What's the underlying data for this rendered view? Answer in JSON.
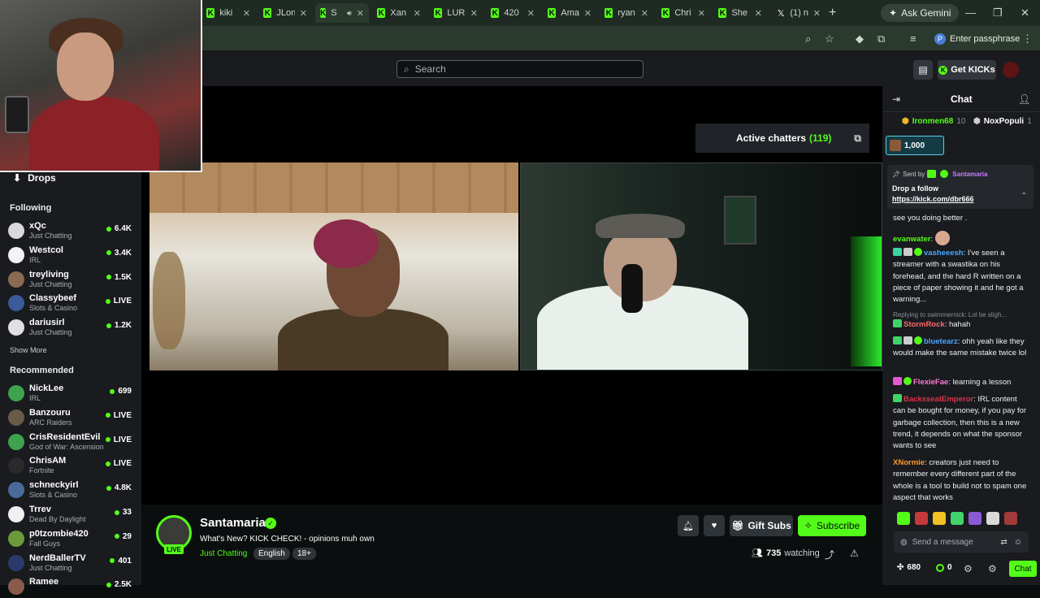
{
  "browser": {
    "tabs": [
      {
        "title": "kiki",
        "icon": "kick"
      },
      {
        "title": "JLon",
        "icon": "kick"
      },
      {
        "title": "S",
        "icon": "kick",
        "active": true
      },
      {
        "title": "Xan",
        "icon": "kick"
      },
      {
        "title": "LUR",
        "icon": "kick"
      },
      {
        "title": "420",
        "icon": "kick"
      },
      {
        "title": "Ama",
        "icon": "kick"
      },
      {
        "title": "ryan",
        "icon": "kick"
      },
      {
        "title": "Chri",
        "icon": "kick"
      },
      {
        "title": "She",
        "icon": "kick"
      },
      {
        "title": "(1) n",
        "icon": "x"
      }
    ],
    "ask_gemini": "Ask Gemini",
    "passphrase": "Enter passphrase",
    "passphrase_initial": "P"
  },
  "header": {
    "search_placeholder": "Search",
    "get_kicks": "Get KICKs"
  },
  "sidebar": {
    "drops": "Drops",
    "following_title": "Following",
    "following": [
      {
        "name": "xQc",
        "category": "Just Chatting",
        "viewers": "6.4K",
        "color": "#d9d9d9"
      },
      {
        "name": "Westcol",
        "category": "IRL",
        "viewers": "3.4K",
        "color": "#f2f2f2"
      },
      {
        "name": "treyliving",
        "category": "Just Chatting",
        "viewers": "1.5K",
        "color": "#8a6a50"
      },
      {
        "name": "Classybeef",
        "category": "Slots & Casino",
        "viewers": "LIVE",
        "color": "#3a5a9a"
      },
      {
        "name": "dariusirl",
        "category": "Just Chatting",
        "viewers": "1.2K",
        "color": "#e0e0e0"
      }
    ],
    "show_more": "Show More",
    "recommended_title": "Recommended",
    "recommended": [
      {
        "name": "NickLee",
        "category": "IRL",
        "viewers": "699",
        "color": "#3fa34d"
      },
      {
        "name": "Banzouru",
        "category": "ARC Raiders",
        "viewers": "LIVE",
        "color": "#6a5a48"
      },
      {
        "name": "CrisResidentEvil",
        "category": "God of War: Ascension",
        "viewers": "LIVE",
        "color": "#3fa34d"
      },
      {
        "name": "ChrisAM",
        "category": "Fortnite",
        "viewers": "LIVE",
        "color": "#2a2a2a"
      },
      {
        "name": "schneckyirl",
        "category": "Slots & Casino",
        "viewers": "4.8K",
        "color": "#4a6a9a"
      },
      {
        "name": "Trrev",
        "category": "Dead By Daylight",
        "viewers": "33",
        "color": "#f0f0f0"
      },
      {
        "name": "p0tzombie420",
        "category": "Fall Guys",
        "viewers": "29",
        "color": "#6a9a3a"
      },
      {
        "name": "NerdBallerTV",
        "category": "Just Chatting",
        "viewers": "401",
        "color": "#2a3a6a"
      },
      {
        "name": "Ramee",
        "category": "",
        "viewers": "2.5K",
        "color": "#8a5a4a"
      }
    ]
  },
  "player": {
    "active_chatters_label": "Active chatters",
    "active_chatters_count": "(119)"
  },
  "stream": {
    "streamer": "Santamaria",
    "title": "What's New? KICK CHECK! - opinions muh own",
    "category": "Just Chatting",
    "tags": [
      "English",
      "18+"
    ],
    "live_badge": "LIVE",
    "gift_subs": "Gift Subs",
    "subscribe": "Subscribe",
    "viewers": "735",
    "watching_label": "watching"
  },
  "chat": {
    "title": "Chat",
    "leaderboard": [
      {
        "name": "Ironmen68",
        "count": "10"
      },
      {
        "name": "NoxPopuli",
        "count": "1"
      }
    ],
    "goal_value": "1,000",
    "pinned": {
      "sent_by": "Sent by",
      "sender": "Santamaria",
      "message": "Drop a follow",
      "link": "https://kick.com/dbr666"
    },
    "messages": [
      {
        "user": "",
        "user_color": "#eef0f2",
        "text": "see you doing better .",
        "badges": []
      },
      {
        "user": "evanwater",
        "user_color": "#53fc18",
        "text": "",
        "badges": []
      },
      {
        "user": "vasheeesh",
        "user_color": "#4aa8ff",
        "text": "I've seen a streamer with a swastika on his forehead, and the hard R written on a piece of paper showing it and he got a warning...",
        "badges": [
          "#3fd3a0",
          "#cccccc",
          "verified"
        ]
      },
      {
        "user": "StormRock",
        "user_color": "#ff6b6b",
        "text": "hahah",
        "badges": [
          "#3fd36a"
        ]
      },
      {
        "user": "bluetearz",
        "user_color": "#4aa8ff",
        "text": "ohh yeah like they would make the same mistake twice lol",
        "badges": [
          "#3fd36a",
          "#cccccc",
          "verified"
        ]
      },
      {
        "user": "FlexieFae",
        "user_color": "#ff7ad9",
        "text": "learning a lesson",
        "badges": [
          "#e35ad0",
          "verified"
        ]
      },
      {
        "user": "BacksseatEmperor",
        "user_color": "#e0304a",
        "text": "IRL content can be bought for money, if you pay for garbage collection, then this is a new trend, it depends on what the sponsor wants to see",
        "badges": [
          "#3fd36a"
        ]
      },
      {
        "user": "XNormie",
        "user_color": "#ff9a2a",
        "text": "creators just need to remember every different part of the whole is a tool to build not to spam one aspect that works",
        "badges": []
      }
    ],
    "reply_label": "Replying to swimmernick: Lol be sligh...",
    "reply_to": "swimmernick",
    "send_placeholder": "Send a message",
    "kicks_count": "680",
    "points": "0",
    "chat_button": "Chat"
  }
}
